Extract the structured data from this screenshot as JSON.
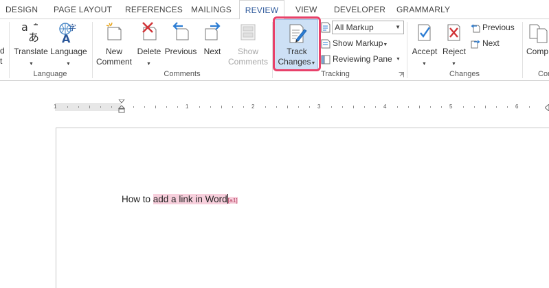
{
  "tabs": [
    {
      "label": "DESIGN",
      "active": false
    },
    {
      "label": "PAGE LAYOUT",
      "active": false
    },
    {
      "label": "REFERENCES",
      "active": false
    },
    {
      "label": "MAILINGS",
      "active": false
    },
    {
      "label": "REVIEW",
      "active": true
    },
    {
      "label": "VIEW",
      "active": false
    },
    {
      "label": "DEVELOPER",
      "active": false
    },
    {
      "label": "GRAMMARLY",
      "active": false
    }
  ],
  "ribbon": {
    "partial_left_top": "d",
    "partial_left_bottom": "t",
    "language_group": {
      "label": "Language",
      "translate": "Translate",
      "language": "Language"
    },
    "comments_group": {
      "label": "Comments",
      "new_comment_line1": "New",
      "new_comment_line2": "Comment",
      "delete": "Delete",
      "previous": "Previous",
      "next": "Next",
      "show_comments_line1": "Show",
      "show_comments_line2": "Comments"
    },
    "tracking_group": {
      "label": "Tracking",
      "track_changes_line1": "Track",
      "track_changes_line2": "Changes",
      "markup_select": "All Markup",
      "show_markup": "Show Markup",
      "reviewing_pane": "Reviewing Pane"
    },
    "changes_group": {
      "label": "Changes",
      "accept": "Accept",
      "reject": "Reject",
      "previous": "Previous",
      "next": "Next"
    },
    "partial_right_top": "Comp",
    "partial_right_label": "Comp"
  },
  "ruler": {
    "numbers": [
      "1",
      "1",
      "2",
      "3",
      "4",
      "5",
      "6"
    ]
  },
  "document": {
    "text_before": "How to ",
    "inserted_part1": "add a link in W",
    "inserted_part2": "ord",
    "tag": "[a1]"
  },
  "colors": {
    "accent": "#2b579a",
    "highlight_ring": "#e8416a",
    "track_active_bg": "#cde0f5",
    "insertion_bg": "#f7cfdc"
  }
}
